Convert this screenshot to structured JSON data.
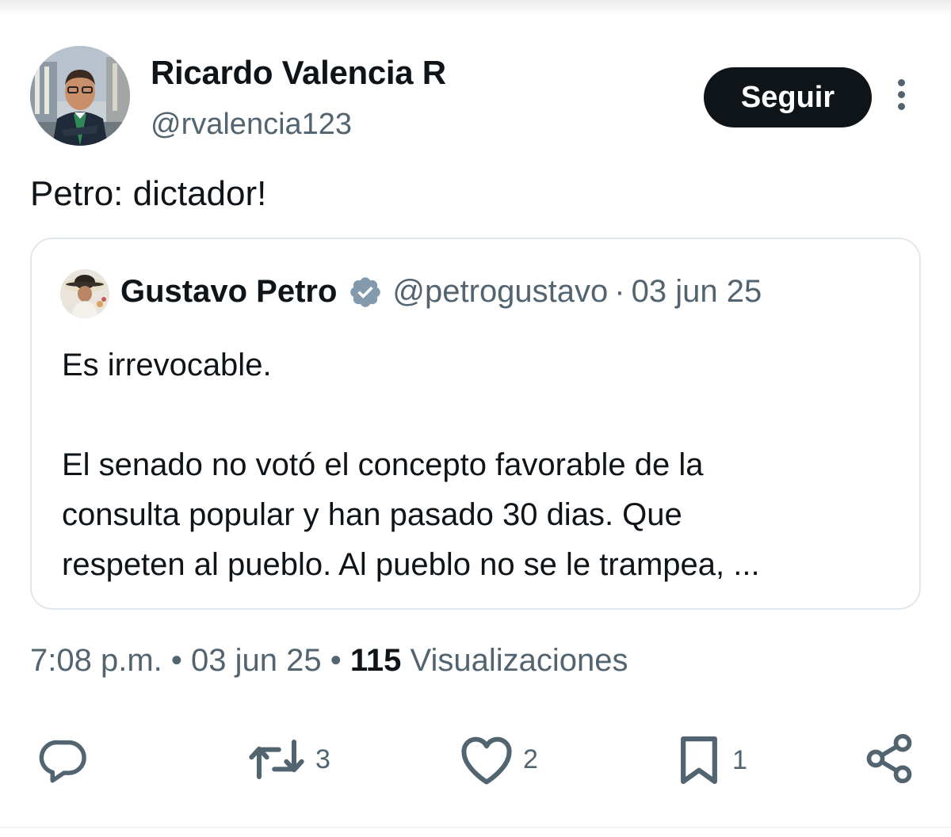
{
  "author": {
    "name": "Ricardo Valencia R",
    "handle": "@rvalencia123",
    "follow_label": "Seguir",
    "avatar_icon": "profile-photo"
  },
  "tweet": {
    "text": "Petro: dictador!"
  },
  "quoted": {
    "name": "Gustavo Petro",
    "verified_icon": "verified-badge-icon",
    "handle": "@petrogustavo",
    "separator": "·",
    "date": "03 jun 25",
    "lines": [
      "Es irrevocable.",
      "El senado no votó el concepto favorable de la",
      "consulta popular y han pasado 30 dias. Que",
      "respeten al pueblo. Al pueblo no se le trampea, ..."
    ]
  },
  "meta": {
    "time": "7:08 p.m.",
    "dot": "•",
    "date": "03 jun 25",
    "views_count": "115",
    "views_label": "Visualizaciones"
  },
  "actions": {
    "reply_icon": "reply-icon",
    "retweet_icon": "retweet-icon",
    "retweet_count": "3",
    "like_icon": "heart-icon",
    "like_count": "2",
    "bookmark_icon": "bookmark-icon",
    "bookmark_count": "1",
    "share_icon": "share-icon"
  },
  "colors": {
    "text": "#0f1419",
    "secondary": "#536471",
    "border": "#e1e8ed",
    "follow_bg": "#0f1419",
    "verified": "#829aab"
  }
}
